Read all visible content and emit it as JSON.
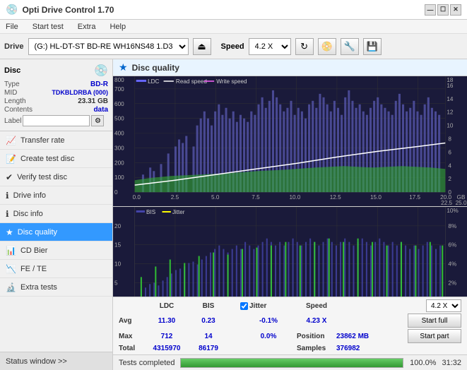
{
  "titlebar": {
    "title": "Opti Drive Control 1.70",
    "icon": "💿",
    "min": "—",
    "max": "☐",
    "close": "✕"
  },
  "menu": {
    "items": [
      "File",
      "Start test",
      "Extra",
      "Help"
    ]
  },
  "toolbar": {
    "drive_label": "Drive",
    "drive_value": "(G:) HL-DT-ST BD-RE  WH16NS48 1.D3",
    "eject_icon": "⏏",
    "speed_label": "Speed",
    "speed_value": "4.2 X",
    "refresh_icon": "↻",
    "btn1_icon": "📀",
    "btn2_icon": "🔧",
    "btn3_icon": "💾"
  },
  "sidebar": {
    "disc_title": "Disc",
    "disc_icon": "💿",
    "disc_type_label": "Type",
    "disc_type_value": "BD-R",
    "disc_mid_label": "MID",
    "disc_mid_value": "TDKBLDRBA (000)",
    "disc_length_label": "Length",
    "disc_length_value": "23.31 GB",
    "disc_contents_label": "Contents",
    "disc_contents_value": "data",
    "disc_label_label": "Label",
    "disc_label_value": "",
    "nav_items": [
      {
        "id": "transfer-rate",
        "icon": "📈",
        "label": "Transfer rate"
      },
      {
        "id": "create-test",
        "icon": "📝",
        "label": "Create test disc"
      },
      {
        "id": "verify-test",
        "icon": "✔",
        "label": "Verify test disc"
      },
      {
        "id": "drive-info",
        "icon": "ℹ",
        "label": "Drive info"
      },
      {
        "id": "disc-info",
        "icon": "ℹ",
        "label": "Disc info"
      },
      {
        "id": "disc-quality",
        "icon": "★",
        "label": "Disc quality",
        "active": true
      },
      {
        "id": "cd-bier",
        "icon": "📊",
        "label": "CD Bier"
      },
      {
        "id": "fe-te",
        "icon": "📉",
        "label": "FE / TE"
      },
      {
        "id": "extra-tests",
        "icon": "🔬",
        "label": "Extra tests"
      }
    ],
    "status_window_label": "Status window >>"
  },
  "disc_quality": {
    "title": "Disc quality",
    "icon": "★",
    "legend_upper": [
      {
        "label": "LDC",
        "color": "#6666ff"
      },
      {
        "label": "Read speed",
        "color": "#ffffff"
      },
      {
        "label": "Write speed",
        "color": "#ff66ff"
      }
    ],
    "legend_lower": [
      {
        "label": "BIS",
        "color": "#6666ff"
      },
      {
        "label": "Jitter",
        "color": "#ffff00"
      }
    ],
    "upper_y_left_max": 800,
    "upper_y_right_max": 18,
    "lower_y_left_max": 20,
    "lower_y_right_max": 10,
    "x_max": 25
  },
  "stats": {
    "headers": [
      "",
      "LDC",
      "BIS",
      "",
      "Jitter",
      "Speed",
      ""
    ],
    "avg_label": "Avg",
    "avg_ldc": "11.30",
    "avg_bis": "0.23",
    "avg_jitter": "-0.1%",
    "speed_label": "Speed",
    "speed_value": "4.23 X",
    "speed_select": "4.2 X",
    "max_label": "Max",
    "max_ldc": "712",
    "max_bis": "14",
    "max_jitter": "0.0%",
    "position_label": "Position",
    "position_value": "23862 MB",
    "start_full_label": "Start full",
    "total_label": "Total",
    "total_ldc": "4315970",
    "total_bis": "86179",
    "samples_label": "Samples",
    "samples_value": "376982",
    "start_part_label": "Start part"
  },
  "statusbar": {
    "label": "Tests completed",
    "progress_pct": "100.0%",
    "progress_value": 100,
    "time": "31:32"
  }
}
